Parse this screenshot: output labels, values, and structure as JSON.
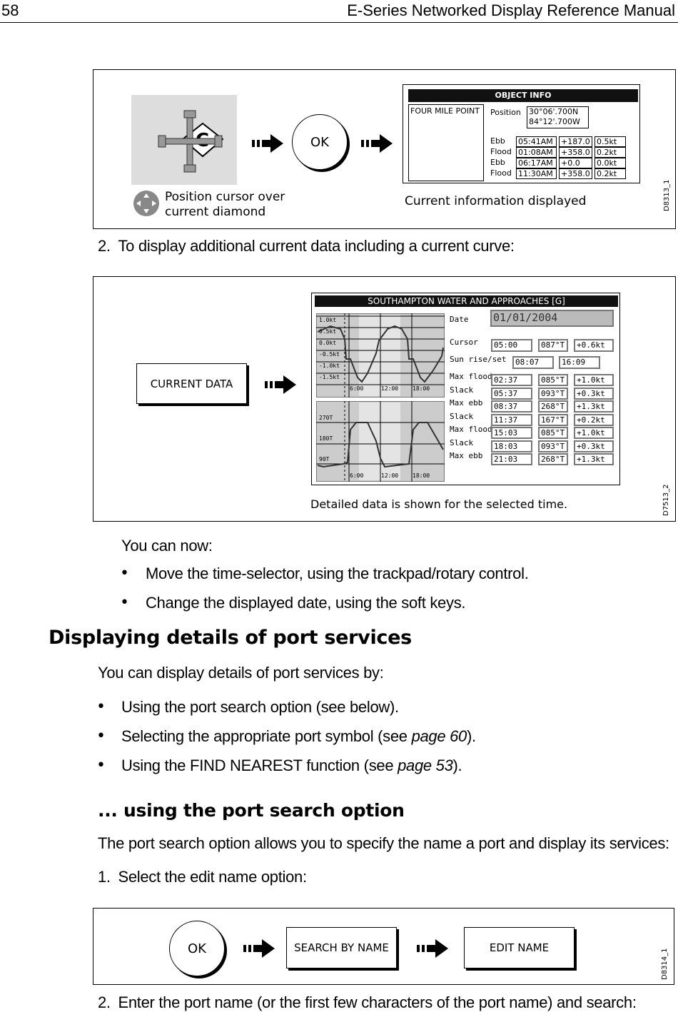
{
  "header": {
    "page_number": "58",
    "manual_title": "E-Series Networked Display Reference Manual"
  },
  "figure1": {
    "caption_left": [
      "Position cursor over",
      "current diamond"
    ],
    "ok": "OK",
    "caption_right": "Current information displayed",
    "code": "D8313_1",
    "object_info": {
      "title": "OBJECT INFO",
      "name": "FOUR MILE POINT",
      "position_label": "Position",
      "lat": "30°06'.700N",
      "lon": "84°12'.700W",
      "rows": [
        {
          "label": "Ebb",
          "time": "05:41AM",
          "dir": "+187.0",
          "speed": "0.5kt"
        },
        {
          "label": "Flood",
          "time": "01:08AM",
          "dir": "+358.0",
          "speed": "0.2kt"
        },
        {
          "label": "Ebb",
          "time": "06:17AM",
          "dir": "+0.0",
          "speed": "0.0kt"
        },
        {
          "label": "Flood",
          "time": "11:30AM",
          "dir": "+358.0",
          "speed": "0.2kt"
        }
      ]
    }
  },
  "step2": "2. To display additional current data including a current curve:",
  "figure2": {
    "button": "CURRENT DATA",
    "caption": "Detailed data is shown for the selected time.",
    "code": "D7513_2",
    "screen": {
      "title": "SOUTHAMPTON WATER AND APPROACHES [G]",
      "speed_axis": [
        "1.0kt",
        "0.5kt",
        "0.0kt",
        "-0.5kt",
        "-1.0kt",
        "-1.5kt"
      ],
      "dir_axis": [
        "270T",
        "180T",
        "90T"
      ],
      "time_axis": [
        "6:00",
        "12:00",
        "18:00"
      ],
      "date_label": "Date",
      "date": "01/01/2004",
      "cursor": {
        "label": "Cursor",
        "time": "05:00",
        "dir": "087°T",
        "speed": "+0.6kt"
      },
      "sun": {
        "label": "Sun rise/set",
        "rise": "08:07",
        "set": "16:09"
      },
      "rows": [
        {
          "label": "Max flood",
          "time": "02:37",
          "dir": "085°T",
          "speed": "+1.0kt"
        },
        {
          "label": "Slack",
          "time": "05:37",
          "dir": "093°T",
          "speed": "+0.3kt"
        },
        {
          "label": "Max ebb",
          "time": "08:37",
          "dir": "268°T",
          "speed": "+1.3kt"
        },
        {
          "label": "Slack",
          "time": "11:37",
          "dir": "167°T",
          "speed": "+0.2kt"
        },
        {
          "label": "Max flood",
          "time": "15:03",
          "dir": "085°T",
          "speed": "+1.0kt"
        },
        {
          "label": "Slack",
          "time": "18:03",
          "dir": "093°T",
          "speed": "+0.3kt"
        },
        {
          "label": "Max ebb",
          "time": "21:03",
          "dir": "268°T",
          "speed": "+1.3kt"
        }
      ]
    }
  },
  "you_can_now": "You can now:",
  "bullets1": [
    "Move the time-selector, using the trackpad/rotary control.",
    "Change the displayed date, using the soft keys."
  ],
  "heading": "Displaying details of port services",
  "intro": "You can display details of port services by:",
  "bullets2": [
    {
      "text": "Using the port search option (see below)."
    },
    {
      "text": "Selecting the appropriate port symbol (see ",
      "link": "page 60",
      "after": ")."
    },
    {
      "text": "Using the FIND NEAREST function (see ",
      "link": "page 53",
      "after": ")."
    }
  ],
  "subheading": "... using the port search option",
  "sub_intro": "The port search option allows you to specify the name a port and display its services:",
  "step1": "1. Select the edit name option:",
  "figure3": {
    "ok": "OK",
    "search": "SEARCH BY NAME",
    "edit": "EDIT NAME",
    "code": "D8314_1"
  },
  "step2b": "2. Enter the port name (or the first few characters of the port name) and search:"
}
